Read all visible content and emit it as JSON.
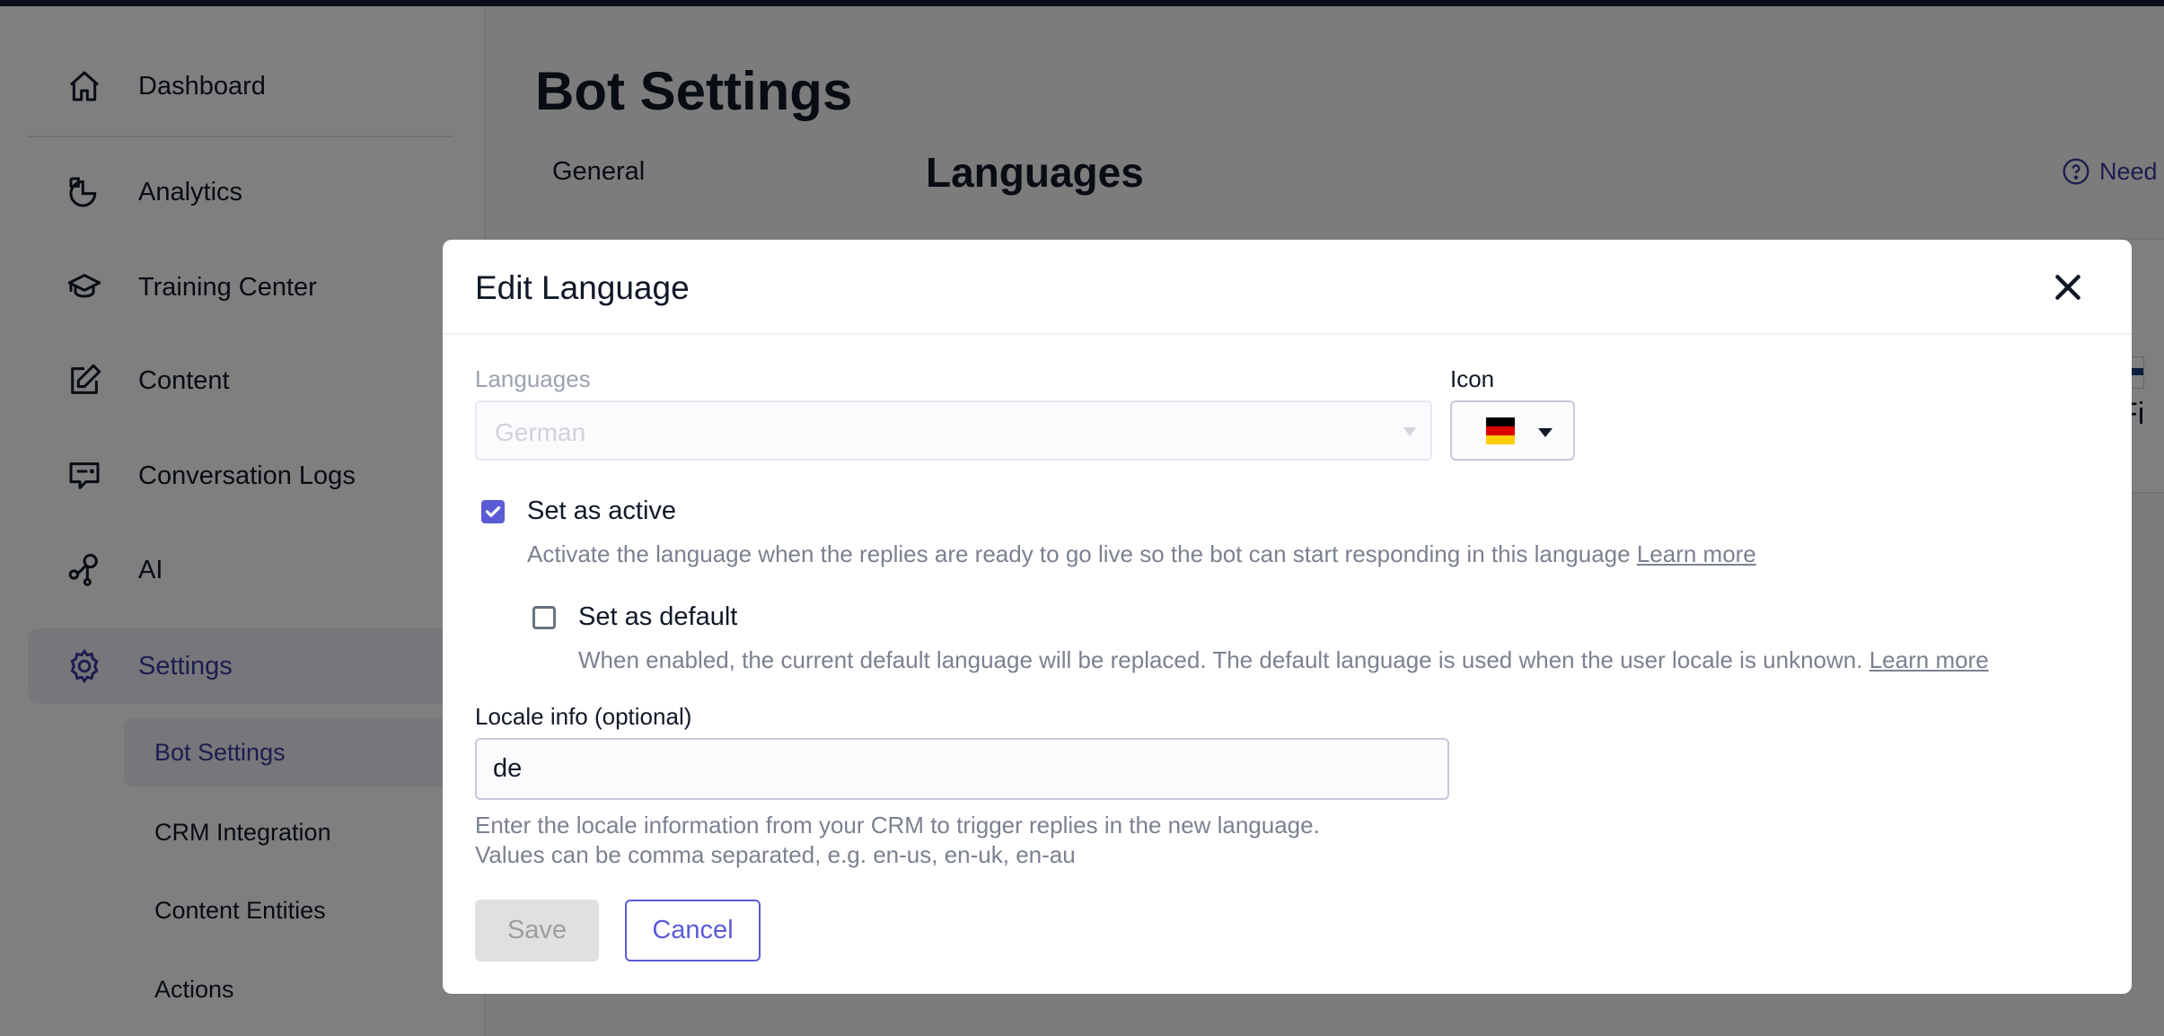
{
  "sidebar": {
    "items": [
      {
        "label": "Dashboard",
        "icon": "home-icon"
      },
      {
        "label": "Analytics",
        "icon": "pie-chart-icon"
      },
      {
        "label": "Training Center",
        "icon": "graduation-cap-icon"
      },
      {
        "label": "Content",
        "icon": "edit-icon"
      },
      {
        "label": "Conversation Logs",
        "icon": "chat-icon"
      },
      {
        "label": "AI",
        "icon": "nodes-icon"
      },
      {
        "label": "Settings",
        "icon": "gear-icon",
        "active": true
      }
    ],
    "sub_items": [
      {
        "label": "Bot Settings",
        "active": true
      },
      {
        "label": "CRM Integration"
      },
      {
        "label": "Content Entities"
      },
      {
        "label": "Actions"
      }
    ]
  },
  "main": {
    "title": "Bot Settings",
    "tab_general": "General",
    "section_title": "Languages",
    "help_link": "Need",
    "background_card_text": "Fi"
  },
  "dialog": {
    "title": "Edit Language",
    "languages_label": "Languages",
    "languages_value": "German",
    "icon_label": "Icon",
    "icon_value": "german-flag",
    "set_active": {
      "label": "Set as active",
      "checked": true,
      "help": "Activate the language when the replies are ready to go live so the bot can start responding in this language",
      "link": "Learn more"
    },
    "set_default": {
      "label": "Set as default",
      "checked": false,
      "help": "When enabled, the current default language will be replaced. The default language is used when the user locale is unknown.",
      "link": "Learn more"
    },
    "locale_label": "Locale info (optional)",
    "locale_value": "de",
    "locale_help": "Enter the locale information from your CRM to trigger replies in the new language. Values can be comma separated, e.g. en-us, en-uk, en-au",
    "save_label": "Save",
    "cancel_label": "Cancel"
  },
  "colors": {
    "accent": "#5b5bd6",
    "active_nav_text": "#3b3b9e",
    "overlay": "rgba(0,0,0,0.5)"
  }
}
